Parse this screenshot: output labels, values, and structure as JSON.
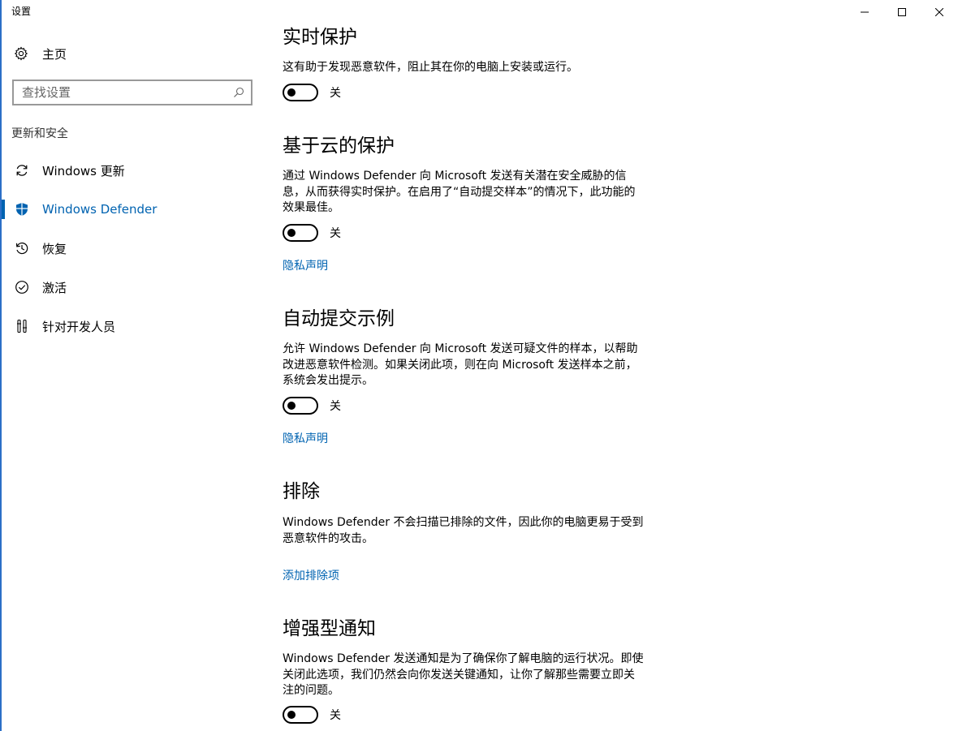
{
  "window": {
    "title": "设置",
    "buttons": {
      "minimize": "minimize-icon",
      "maximize": "maximize-icon",
      "close": "close-icon"
    }
  },
  "sidebar": {
    "home_label": "主页",
    "search_placeholder": "查找设置",
    "section_label": "更新和安全",
    "items": [
      {
        "label": "Windows 更新",
        "icon": "sync-icon",
        "active": false
      },
      {
        "label": "Windows Defender",
        "icon": "shield-icon",
        "active": true
      },
      {
        "label": "恢复",
        "icon": "history-icon",
        "active": false
      },
      {
        "label": "激活",
        "icon": "check-circle-icon",
        "active": false
      },
      {
        "label": "针对开发人员",
        "icon": "developer-tools-icon",
        "active": false
      }
    ]
  },
  "main": {
    "sections": [
      {
        "heading": "实时保护",
        "description": "这有助于发现恶意软件，阻止其在你的电脑上安装或运行。",
        "toggle_state": "关"
      },
      {
        "heading": "基于云的保护",
        "description": "通过 Windows Defender 向 Microsoft 发送有关潜在安全威胁的信息，从而获得实时保护。在启用了“自动提交样本”的情况下，此功能的效果最佳。",
        "toggle_state": "关",
        "link": "隐私声明"
      },
      {
        "heading": "自动提交示例",
        "description": "允许 Windows Defender 向 Microsoft 发送可疑文件的样本，以帮助改进恶意软件检测。如果关闭此项，则在向 Microsoft 发送样本之前，系统会发出提示。",
        "toggle_state": "关",
        "link": "隐私声明"
      },
      {
        "heading": "排除",
        "description": "Windows Defender 不会扫描已排除的文件，因此你的电脑更易于受到恶意软件的攻击。",
        "link": "添加排除项"
      },
      {
        "heading": "增强型通知",
        "description": "Windows Defender 发送通知是为了确保你了解电脑的运行状况。即使关闭此选项，我们仍然会向你发送关键通知，让你了解那些需要立即关注的问题。",
        "toggle_state": "关"
      }
    ]
  },
  "colors": {
    "accent": "#0063b1",
    "window_border": "#2b6fc7",
    "search_border": "#999999"
  }
}
